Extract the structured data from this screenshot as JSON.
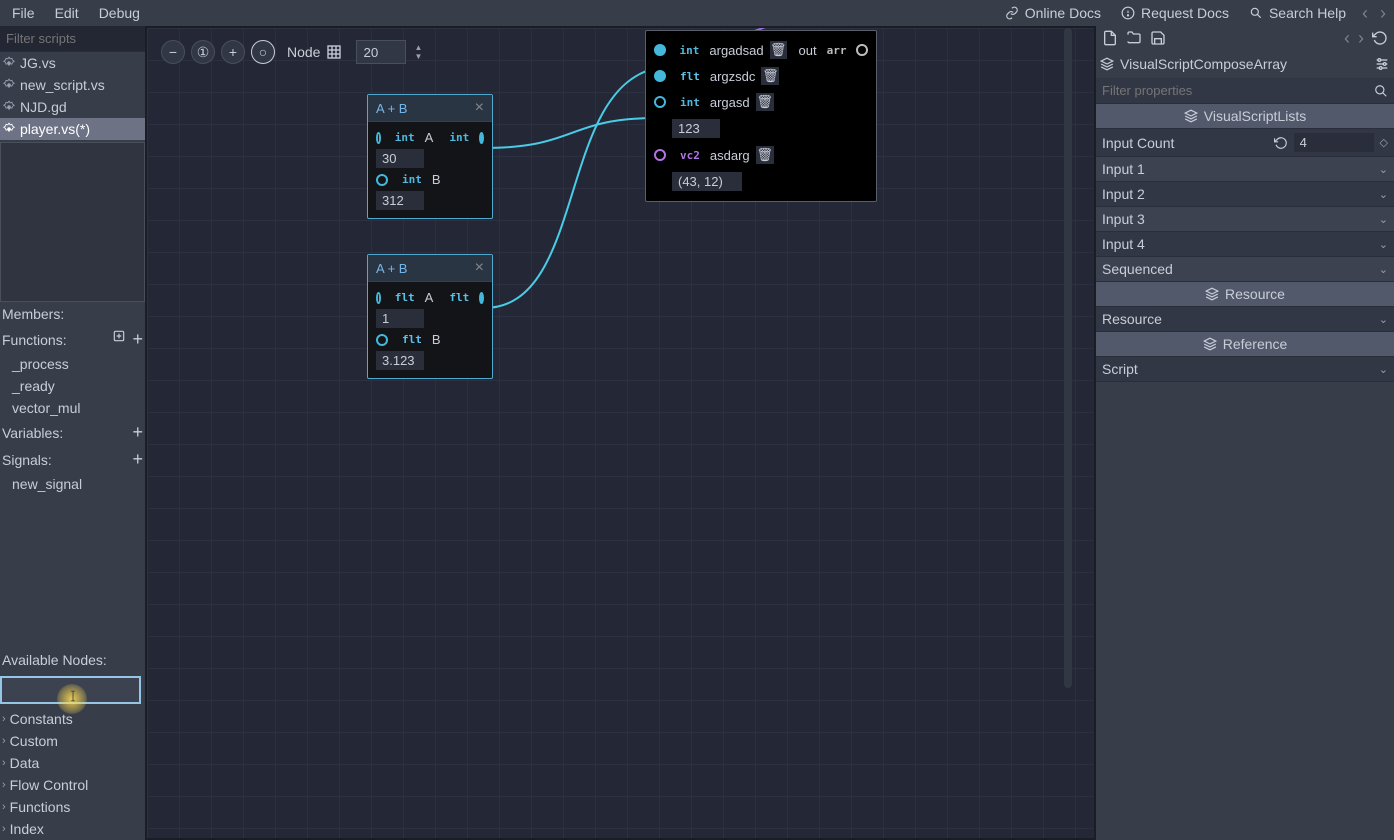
{
  "menu": {
    "file": "File",
    "edit": "Edit",
    "debug": "Debug"
  },
  "help": {
    "online": "Online Docs",
    "request": "Request Docs",
    "search": "Search Help"
  },
  "filter_scripts_placeholder": "Filter scripts",
  "scripts": [
    {
      "name": "JG.vs"
    },
    {
      "name": "new_script.vs"
    },
    {
      "name": "NJD.gd"
    },
    {
      "name": "player.vs(*)"
    }
  ],
  "members_label": "Members:",
  "functions": {
    "label": "Functions:",
    "items": [
      "_process",
      "_ready",
      "vector_mul"
    ]
  },
  "variables": {
    "label": "Variables:"
  },
  "signals": {
    "label": "Signals:",
    "items": [
      "new_signal"
    ]
  },
  "available_nodes_label": "Available Nodes:",
  "node_categories": [
    "Constants",
    "Custom",
    "Data",
    "Flow Control",
    "Functions",
    "Index"
  ],
  "toolbar": {
    "node_label": "Node",
    "zoom": "20"
  },
  "node_int": {
    "title": "A + B",
    "a_label": "A",
    "a_val": "30",
    "b_label": "B",
    "b_val": "312",
    "type": "int"
  },
  "node_flt": {
    "title": "A + B",
    "a_label": "A",
    "a_val": "1",
    "b_label": "B",
    "b_val": "3.123",
    "type": "flt"
  },
  "node_compose": {
    "rows": [
      {
        "type": "int",
        "name": "argadsad",
        "out_label": "out",
        "out_type": "arr"
      },
      {
        "type": "flt",
        "name": "argzsdc"
      },
      {
        "type": "int",
        "name": "argasd"
      }
    ],
    "val1": "123",
    "vec_row": {
      "type": "vc2",
      "name": "asdarg"
    },
    "val2": "(43, 12)"
  },
  "inspector": {
    "class_name": "VisualScriptComposeArray",
    "filter_placeholder": "Filter properties",
    "section1": "VisualScriptLists",
    "input_count_label": "Input Count",
    "input_count": "4",
    "inputs": [
      "Input 1",
      "Input 2",
      "Input 3",
      "Input 4"
    ],
    "sequenced": "Sequenced",
    "resource_hdr": "Resource",
    "resource_prop": "Resource",
    "reference_hdr": "Reference",
    "script_prop": "Script"
  }
}
